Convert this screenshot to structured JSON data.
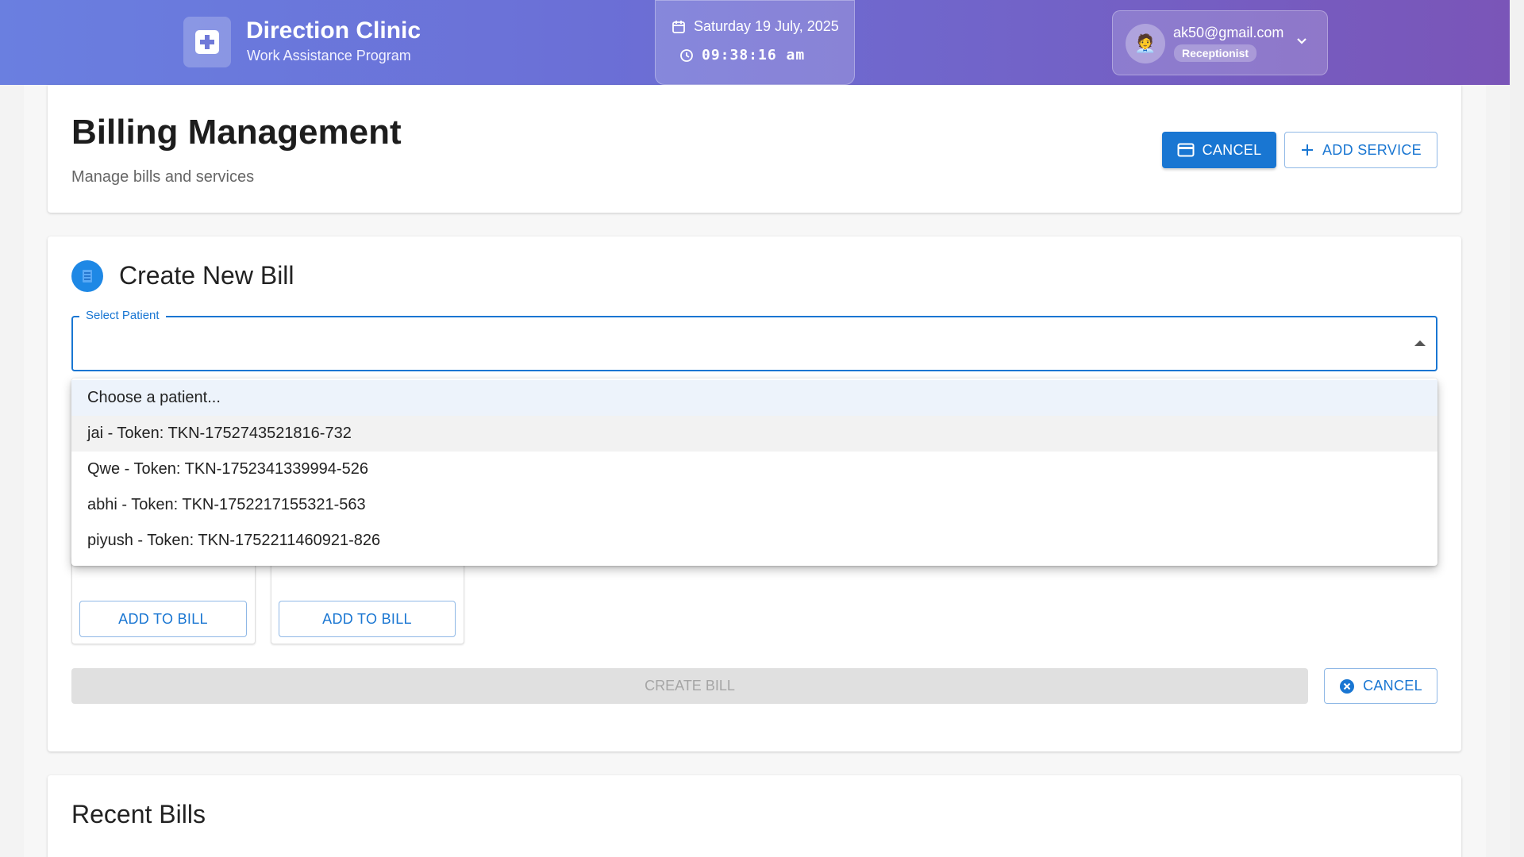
{
  "header": {
    "title": "Direction Clinic",
    "subtitle": "Work Assistance Program",
    "date": "Saturday 19 July, 2025",
    "time": "09:38:16 am",
    "user_email": "ak50@gmail.com",
    "user_role": "Receptionist",
    "avatar_emoji": "🧑‍💼"
  },
  "page": {
    "title": "Billing Management",
    "subtitle": "Manage bills and services",
    "cancel_label": "CANCEL",
    "add_service_label": "ADD SERVICE"
  },
  "create_bill": {
    "title": "Create New Bill",
    "select_label": "Select Patient",
    "add_to_bill_label": "ADD TO BILL",
    "create_bill_label": "CREATE BILL",
    "cancel_label": "CANCEL"
  },
  "patient_options": [
    "Choose a patient...",
    "jai - Token: TKN-1752743521816-732",
    "Qwe - Token: TKN-1752341339994-526",
    "abhi - Token: TKN-1752217155321-563",
    "piyush - Token: TKN-1752211460921-826"
  ],
  "recent": {
    "title": "Recent Bills"
  },
  "colors": {
    "primary": "#1976d2",
    "header_gradient_start": "#6a7fe0",
    "header_gradient_end": "#7a55b8"
  }
}
